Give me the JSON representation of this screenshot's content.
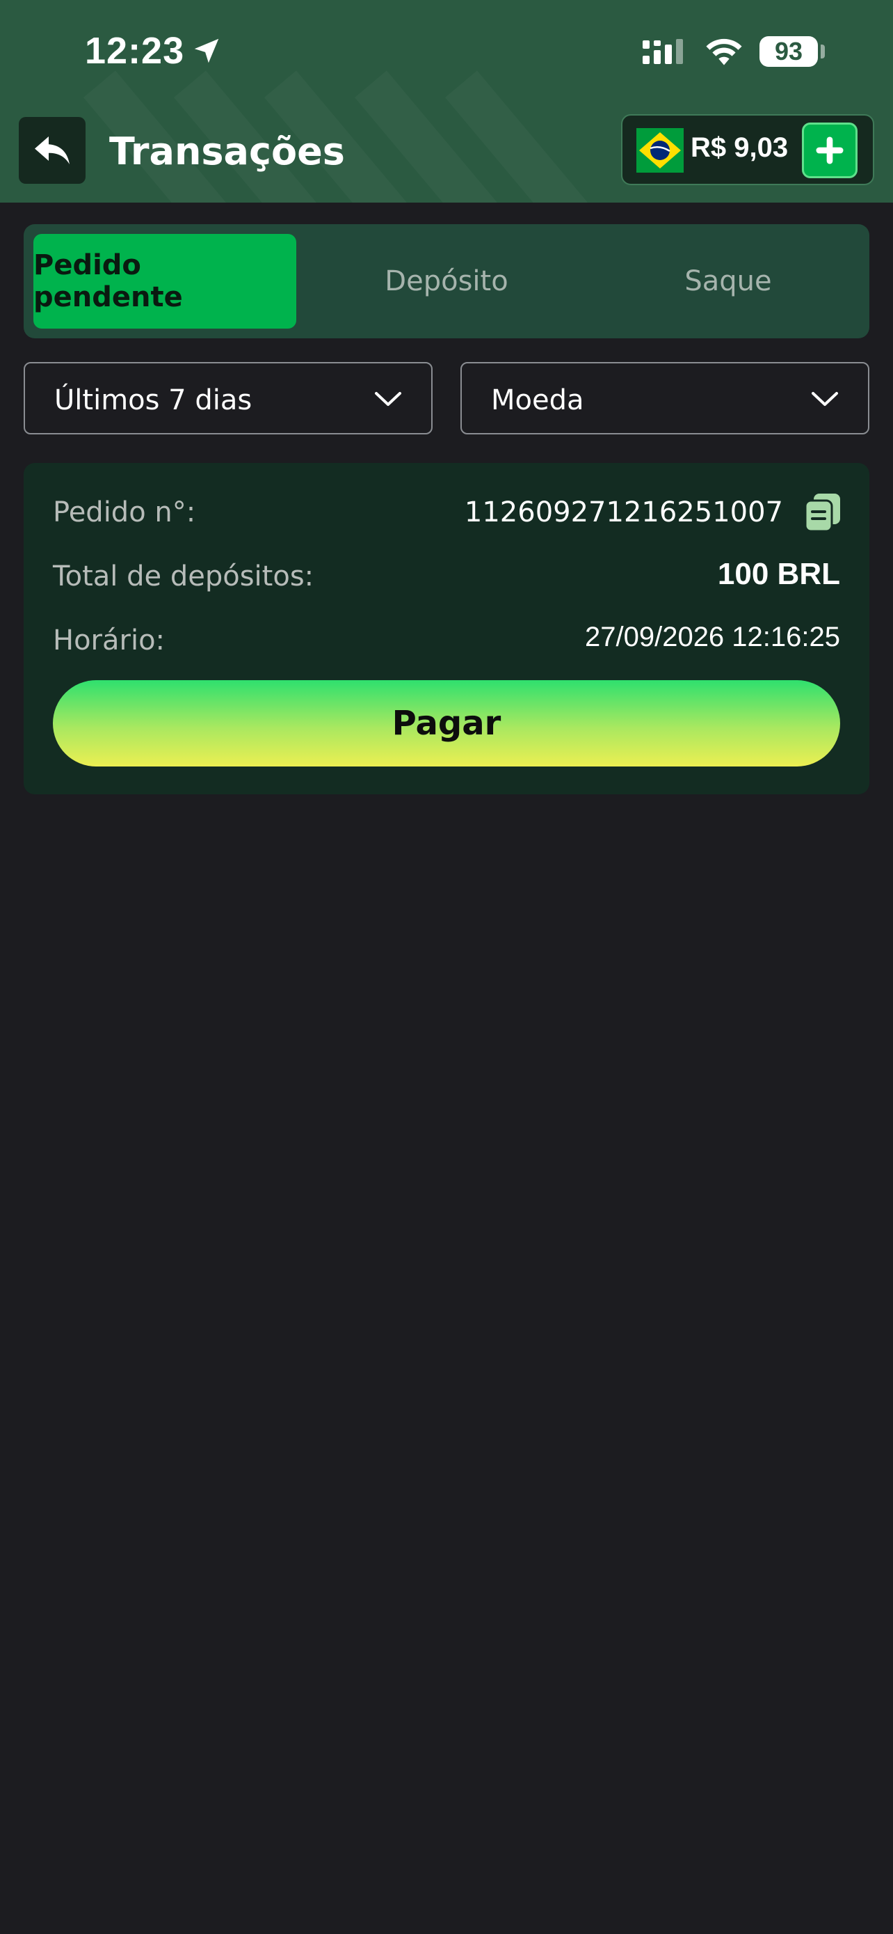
{
  "status_bar": {
    "time": "12:23",
    "battery": "93",
    "location_icon": "location-arrow-icon",
    "signal_icon": "cellular-signal-icon",
    "wifi_icon": "wifi-icon"
  },
  "header": {
    "title": "Transações",
    "back_icon": "reply-arrow-icon",
    "balance": "R$ 9,03",
    "flag_icon": "brazil-flag-icon",
    "add_icon": "plus-icon"
  },
  "tabs": [
    {
      "label": "Pedido pendente",
      "active": true
    },
    {
      "label": "Depósito",
      "active": false
    },
    {
      "label": "Saque",
      "active": false
    }
  ],
  "filters": {
    "period": "Últimos 7 dias",
    "currency": "Moeda",
    "chevron_icon": "chevron-down-icon"
  },
  "order": {
    "order_label": "Pedido n°:",
    "order_number": "112609271216251007",
    "copy_icon": "copy-icon",
    "total_label": "Total de depósitos:",
    "total_value": "100 BRL",
    "time_label": "Horário:",
    "time_value": "27/09/2026 12:16:25",
    "pay_label": "Pagar"
  },
  "colors": {
    "background": "#1c1c20",
    "header": "#2b5a41",
    "accent_green": "#00b34d",
    "card": "#132c22"
  }
}
